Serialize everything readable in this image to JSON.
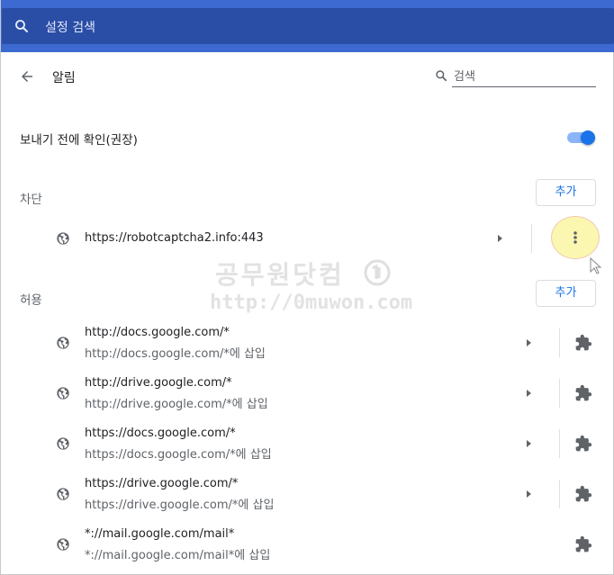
{
  "header": {
    "search_placeholder": "설정 검색",
    "search_icon": "search-icon"
  },
  "page": {
    "title": "알림",
    "back_icon": "arrow-left-icon",
    "search_placeholder": "검색"
  },
  "ask_before_sending": {
    "label": "보내기 전에 확인(권장)",
    "enabled": true
  },
  "blocked": {
    "label": "차단",
    "add_label": "추가",
    "items": [
      {
        "site": "https://robotcaptcha2.info:443"
      }
    ]
  },
  "allowed": {
    "label": "허용",
    "add_label": "추가",
    "items": [
      {
        "site": "http://docs.google.com/*",
        "note": "http://docs.google.com/*에 삽입"
      },
      {
        "site": "http://drive.google.com/*",
        "note": "http://drive.google.com/*에 삽입"
      },
      {
        "site": "https://docs.google.com/*",
        "note": "https://docs.google.com/*에 삽입"
      },
      {
        "site": "https://drive.google.com/*",
        "note": "https://drive.google.com/*에 삽입"
      },
      {
        "site": "*://mail.google.com/mail*",
        "note": "*://mail.google.com/mail*에 삽입"
      }
    ]
  },
  "watermark": {
    "line1": "공무원닷컴",
    "line2": "http://0muwon.com"
  },
  "colors": {
    "header": "#3c6ad0",
    "search_bar": "#2a4ea6",
    "accent": "#1a73e8",
    "highlight": "#fbf7b0"
  }
}
